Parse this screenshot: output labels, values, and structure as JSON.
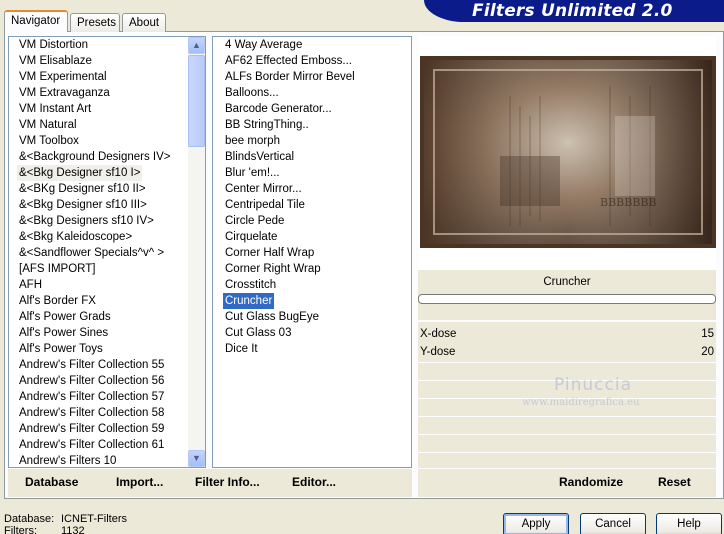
{
  "app": {
    "title": "Filters Unlimited 2.0"
  },
  "tabs": [
    {
      "label": "Navigator",
      "active": true
    },
    {
      "label": "Presets",
      "active": false
    },
    {
      "label": "About",
      "active": false
    }
  ],
  "categories": [
    "VM Distortion",
    "VM Elisablaze",
    "VM Experimental",
    "VM Extravaganza",
    "VM Instant Art",
    "VM Natural",
    "VM Toolbox",
    "&<Background Designers IV>",
    "&<Bkg Designer sf10 I>",
    "&<BKg Designer sf10 II>",
    "&<Bkg Designer sf10 III>",
    "&<Bkg Designers sf10 IV>",
    "&<Bkg Kaleidoscope>",
    "&<Sandflower Specials^v^ >",
    "[AFS IMPORT]",
    "AFH",
    "Alf's Border FX",
    "Alf's Power Grads",
    "Alf's Power Sines",
    "Alf's Power Toys",
    "Andrew's Filter Collection 55",
    "Andrew's Filter Collection 56",
    "Andrew's Filter Collection 57",
    "Andrew's Filter Collection 58",
    "Andrew's Filter Collection 59",
    "Andrew's Filter Collection 61",
    "Andrew's Filters 10"
  ],
  "selected_category_index": 8,
  "filters": [
    "4 Way Average",
    "AF62 Effected Emboss...",
    "ALFs Border Mirror Bevel",
    "Balloons...",
    "Barcode Generator...",
    "BB StringThing..",
    "bee morph",
    "BlindsVertical",
    "Blur 'em!...",
    "Center Mirror...",
    "Centripedal Tile",
    "Circle Pede",
    "Cirquelate",
    "Corner Half Wrap",
    "Corner Right Wrap",
    "Crosstitch",
    "Cruncher",
    "Cut Glass  BugEye",
    "Cut Glass 03",
    "Dice It"
  ],
  "selected_filter_index": 16,
  "selected_filter_name": "Cruncher",
  "progress": 0,
  "params": [
    {
      "label": "X-dose",
      "value": "15"
    },
    {
      "label": "Y-dose",
      "value": "20"
    }
  ],
  "watermark": {
    "name": "Pinuccia",
    "site": "www.maidiregrafica.eu"
  },
  "preview_text": "BBBBBBB",
  "toolbar": {
    "database": "Database",
    "import": "Import...",
    "filter_info": "Filter Info...",
    "editor": "Editor...",
    "randomize": "Randomize",
    "reset": "Reset"
  },
  "footer": {
    "database_label": "Database:",
    "database_value": "ICNET-Filters",
    "filters_label": "Filters:",
    "filters_value": "1132"
  },
  "buttons": {
    "apply": "Apply",
    "cancel": "Cancel",
    "help": "Help"
  },
  "colors": {
    "brand_bg": "#0b1b8a",
    "selection": "#316ac5",
    "tab_accent": "#e68b2c"
  }
}
